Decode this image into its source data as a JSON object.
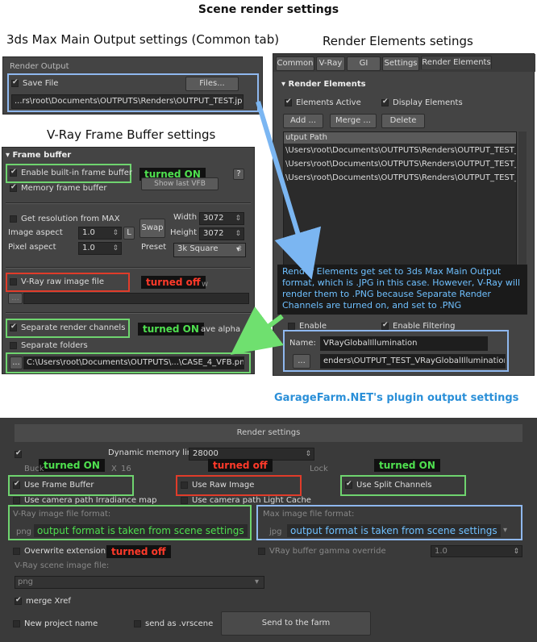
{
  "title": "Scene render settings",
  "main_output": {
    "heading": "3ds Max Main Output settings (Common tab)",
    "group": "Render Output",
    "save_file": "Save File",
    "files_btn": "Files...",
    "path": "...rs\\root\\Documents\\OUTPUTS\\Renders\\OUTPUT_TEST.jpg"
  },
  "render_elements": {
    "heading": "Render Elements setings",
    "tabs": [
      "Common",
      "V-Ray",
      "GI",
      "Settings",
      "Render Elements"
    ],
    "rollout": "Render Elements",
    "elements_active": "Elements Active",
    "display_elements": "Display Elements",
    "add": "Add ...",
    "merge": "Merge ...",
    "delete": "Delete",
    "list_header": "utput Path",
    "rows": [
      "\\Users\\root\\Documents\\OUTPUTS\\Renders\\OUTPUT_TEST_VRa",
      "\\Users\\root\\Documents\\OUTPUTS\\Renders\\OUTPUT_TEST_VRa",
      "\\Users\\root\\Documents\\OUTPUTS\\Renders\\OUTPUT_TEST_VRa"
    ],
    "note": "Render Elements get set to 3ds Max Main Output format, which is .JPG in this case. However, V-Ray will render them to .PNG because Separate Render Channels are turned on, and set to .PNG",
    "enable": "Enable",
    "enable_filtering": "Enable Filtering",
    "name_label": "Name:",
    "name_value": "VRayGlobalIllumination",
    "browse": "...",
    "path": "enders\\OUTPUT_TEST_VRayGlobalIllumination.jpg"
  },
  "vfb": {
    "heading": "V-Ray Frame Buffer settings",
    "rollout": "Frame buffer",
    "enable_builtin": "Enable built-in frame buffer",
    "memory_fb": "Memory frame buffer",
    "show_last": "Show last VFB",
    "turned_on1": "turned ON",
    "get_res": "Get resolution from MAX",
    "image_aspect": "Image aspect",
    "image_aspect_val": "1.0",
    "l_btn": "L",
    "pixel_aspect": "Pixel aspect",
    "pixel_aspect_val": "1.0",
    "swap": "Swap",
    "width_lbl": "Width",
    "width_val": "3072",
    "height_lbl": "Height",
    "height_val": "3072",
    "preset_lbl": "Preset",
    "preset_val": "3k Square",
    "raw": "V-Ray raw image file",
    "turned_off": "turned off",
    "raw_tail": "w",
    "sep_channels": "Separate render channels",
    "turned_on2": "turned ON",
    "save_alpha": "ave alpha",
    "sep_folders": "Separate folders",
    "browse": "...",
    "path": "C:\\Users\\root\\Documents\\OUTPUTS\\...\\CASE_4_VFB.png"
  },
  "garage": {
    "heading": "GarageFarm.NET's plugin output settings",
    "bar": "Render settings",
    "dyn_mem": "Dynamic memory limit",
    "dyn_val": "28000",
    "turned_on_a": "turned ON",
    "turned_off_a": "turned off",
    "turned_on_b": "turned ON",
    "bucket": "Buck",
    "x_lbl": "X",
    "x_val": "16",
    "lock": "Lock",
    "use_fb": "Use Frame Buffer",
    "use_raw": "Use Raw Image",
    "use_split": "Use Split Channels",
    "cam_irr": "Use camera path Irradiance map",
    "cam_lc": "Use camera path Light Cache",
    "vray_fmt": "V-Ray image file format:",
    "png": "png",
    "note_left": "output format is taken from scene settings",
    "max_fmt": "Max image file format:",
    "jpg": "jpg",
    "note_right": "output format is taken from scene settings",
    "overwrite": "Overwrite extension",
    "turned_off_b": "turned off",
    "gamma": "VRay buffer gamma override",
    "gamma_val": "1.0",
    "vray_scene": "V-Ray scene image file:",
    "png2": "png",
    "merge": "merge Xref",
    "new_project": "New project name",
    "send_vrscene": "send as .vrscene",
    "send_farm": "Send to the farm"
  },
  "colors": {
    "blue": "#8fb8ef",
    "green": "#6fd46f",
    "red": "#e03c2a",
    "tag_green": "#4fe04f",
    "tag_red": "#ff3a2a",
    "heading_blue": "#2a8fd8"
  }
}
